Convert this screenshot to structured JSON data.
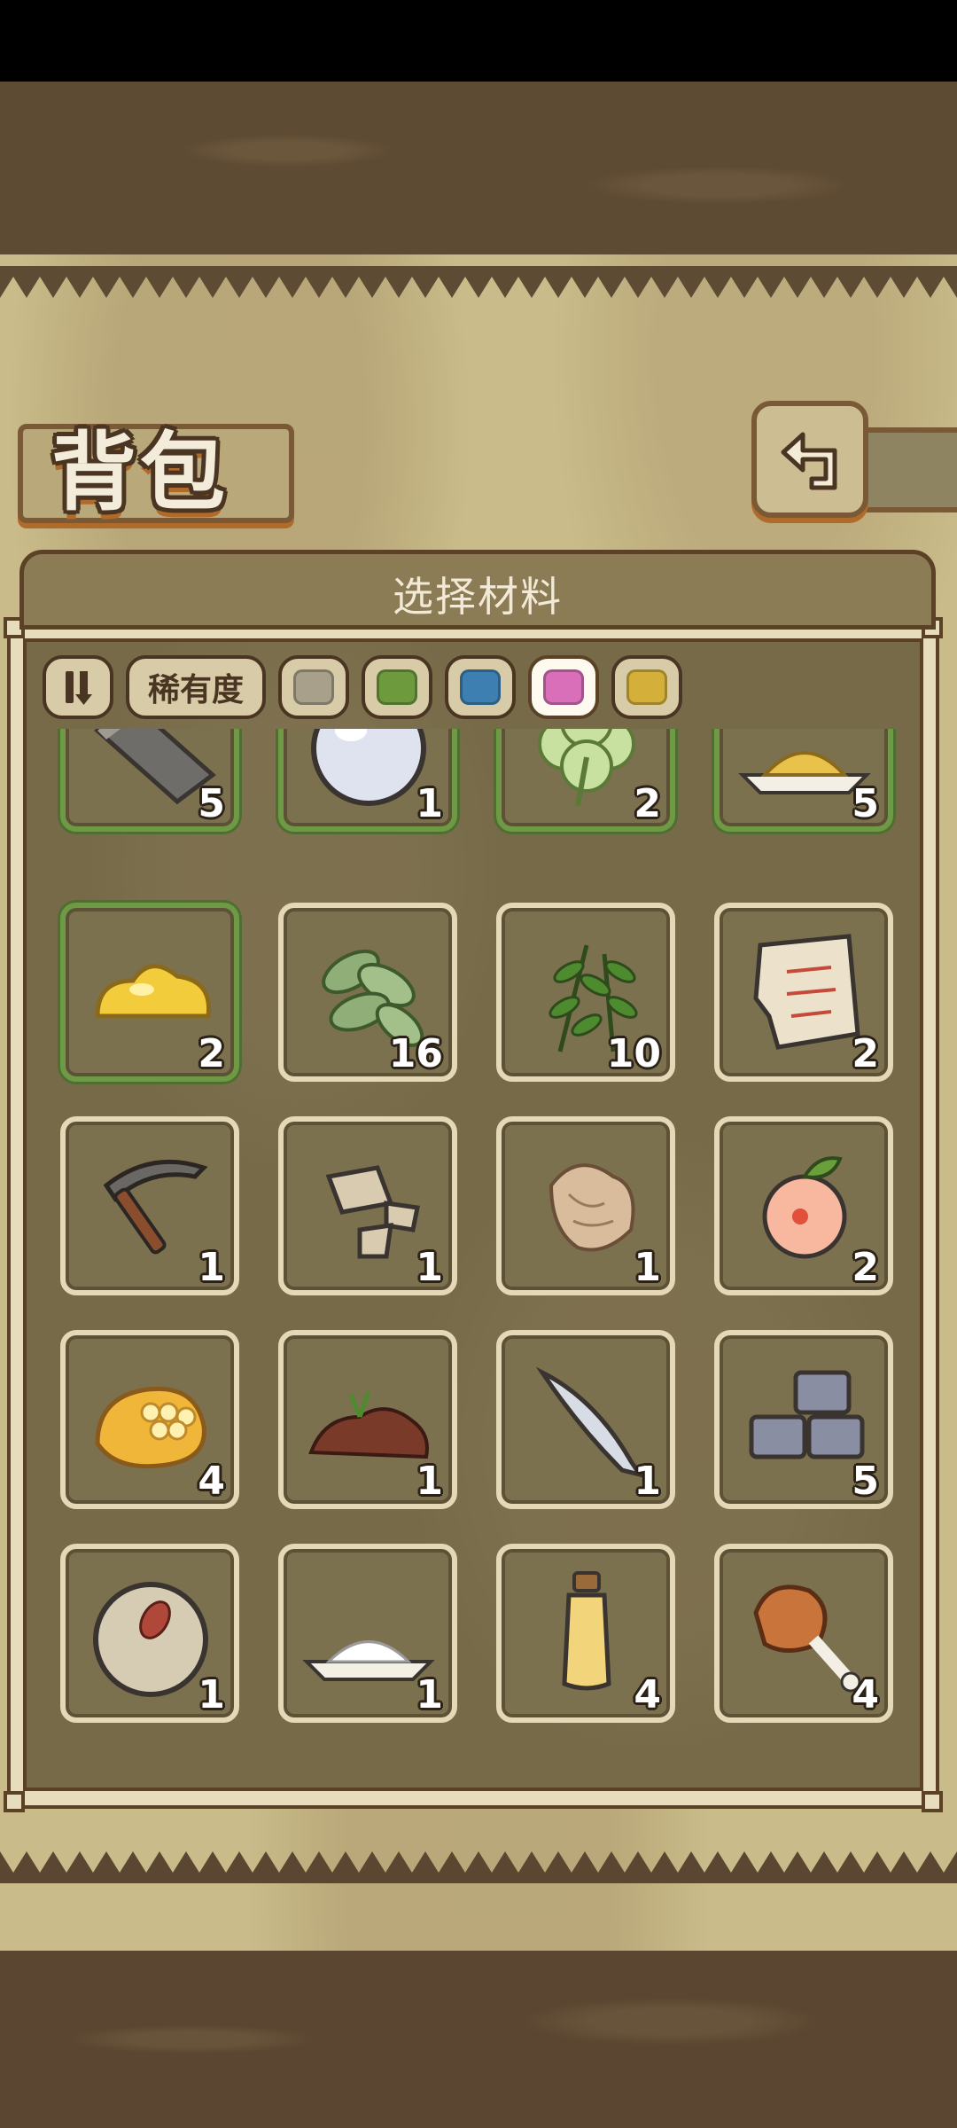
{
  "header": {
    "title": "背包"
  },
  "panel": {
    "title": "选择材料"
  },
  "filters": {
    "rarity_label": "稀有度",
    "swatches": [
      {
        "name": "gray",
        "color": "#a8a08a"
      },
      {
        "name": "green",
        "color": "#6e9a3e"
      },
      {
        "name": "blue",
        "color": "#3d7fb0"
      },
      {
        "name": "pink",
        "color": "#d86fb8",
        "selected": true
      },
      {
        "name": "gold",
        "color": "#d4b03a"
      }
    ]
  },
  "items": [
    {
      "icon": "iron-bar-icon",
      "count": "5",
      "rarity": "green"
    },
    {
      "icon": "pearl-icon",
      "count": "1",
      "rarity": "green"
    },
    {
      "icon": "clover-icon",
      "count": "2",
      "rarity": "green"
    },
    {
      "icon": "grain-pile-icon",
      "count": "5",
      "rarity": "green"
    },
    {
      "icon": "butter-icon",
      "count": "2",
      "rarity": "green"
    },
    {
      "icon": "herb-leaves-icon",
      "count": "16",
      "rarity": "normal"
    },
    {
      "icon": "green-sprigs-icon",
      "count": "10",
      "rarity": "normal"
    },
    {
      "icon": "torn-paper-icon",
      "count": "2",
      "rarity": "normal"
    },
    {
      "icon": "pickaxe-icon",
      "count": "1",
      "rarity": "normal"
    },
    {
      "icon": "stones-icon",
      "count": "1",
      "rarity": "normal"
    },
    {
      "icon": "mushroom-icon",
      "count": "1",
      "rarity": "normal"
    },
    {
      "icon": "peach-icon",
      "count": "2",
      "rarity": "normal"
    },
    {
      "icon": "honeycomb-icon",
      "count": "4",
      "rarity": "normal"
    },
    {
      "icon": "dirt-mound-icon",
      "count": "1",
      "rarity": "normal"
    },
    {
      "icon": "fish-icon",
      "count": "1",
      "rarity": "normal"
    },
    {
      "icon": "stone-blocks-icon",
      "count": "5",
      "rarity": "normal"
    },
    {
      "icon": "seed-ball-icon",
      "count": "1",
      "rarity": "normal"
    },
    {
      "icon": "flour-icon",
      "count": "1",
      "rarity": "normal"
    },
    {
      "icon": "oil-bottle-icon",
      "count": "4",
      "rarity": "normal"
    },
    {
      "icon": "drumstick-icon",
      "count": "4",
      "rarity": "normal"
    }
  ]
}
